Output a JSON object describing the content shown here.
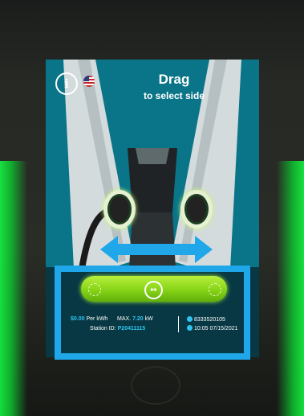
{
  "header": {
    "info_icon": "i",
    "language_flag": "us-flag-icon",
    "title": "Drag",
    "subtitle": "to select side"
  },
  "slider": {
    "knob_icon": "↔"
  },
  "station": {
    "price": "$0.00",
    "price_unit": "Per kWh",
    "max_label": "MAX.",
    "max_value": "7.20",
    "max_unit": "kW",
    "id_label": "Station ID:",
    "id_value": "P20411115",
    "phone": "8333520105",
    "datetime": "10:05 07/15/2021"
  },
  "colors": {
    "accent": "#1fa7ea",
    "slider": "#86d416",
    "led": "#15ff45"
  }
}
